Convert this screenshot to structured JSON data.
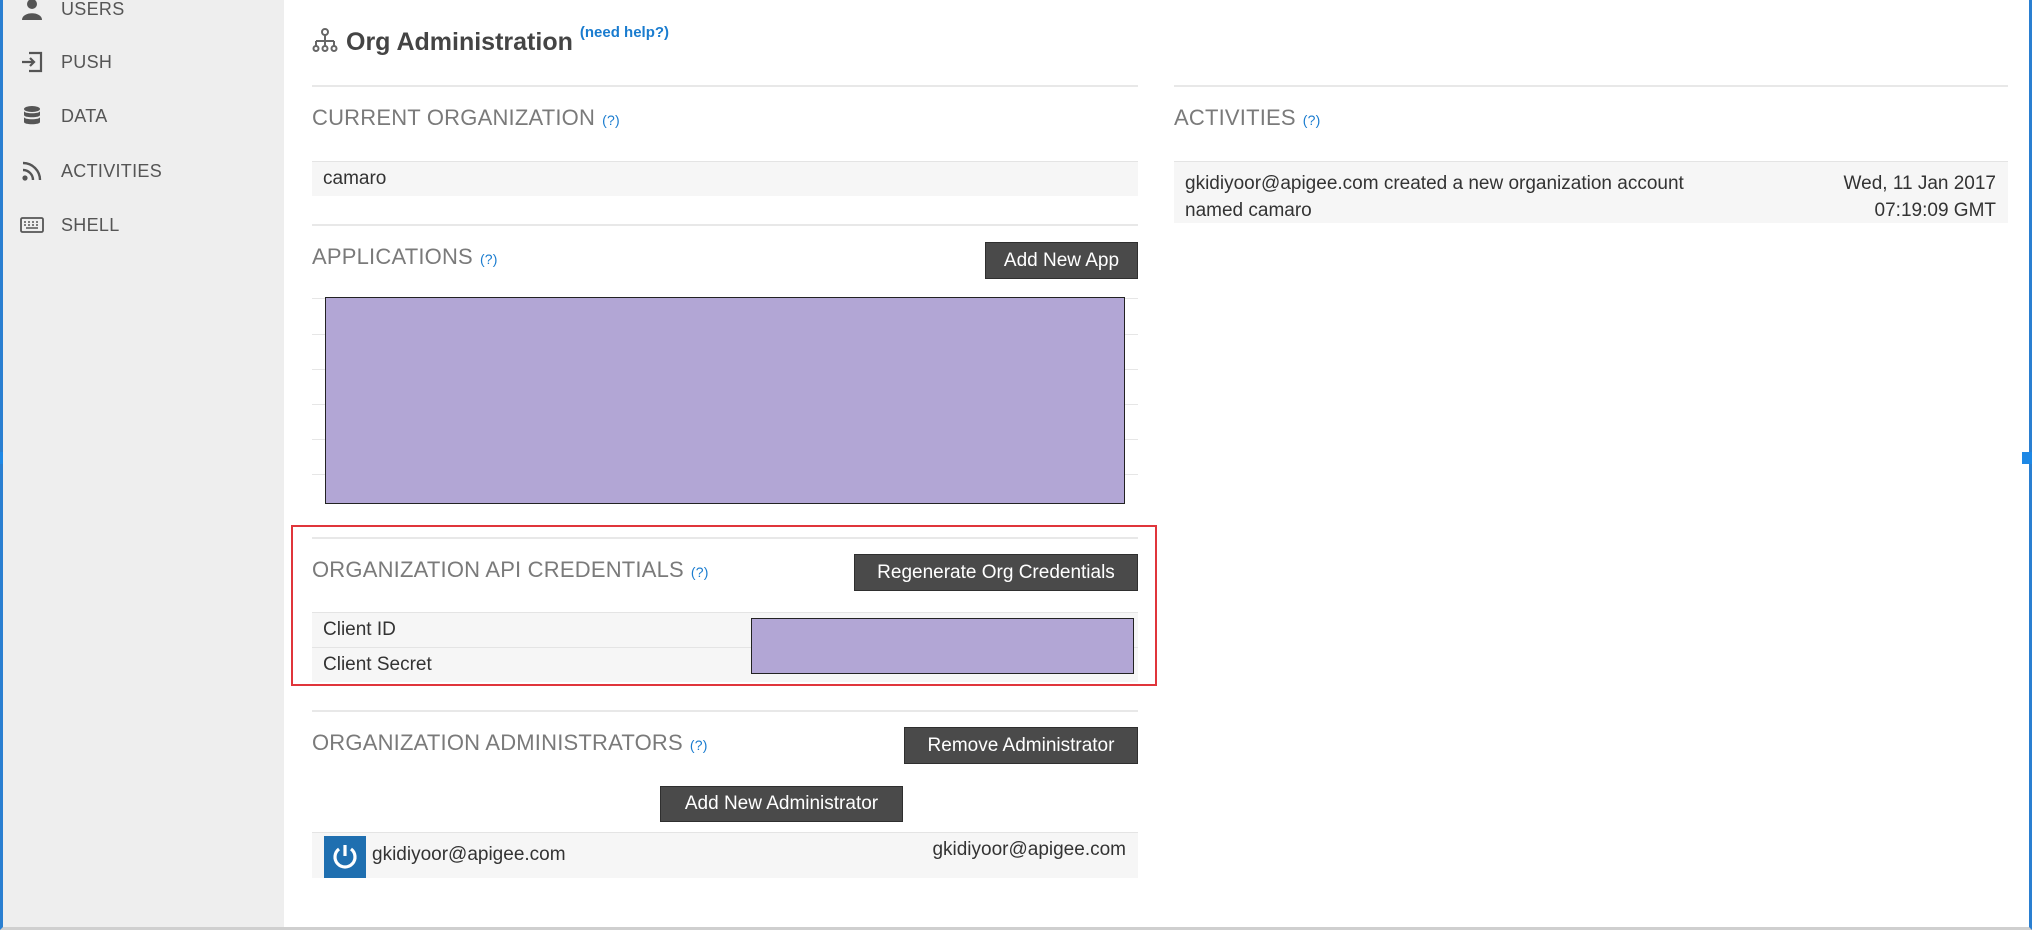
{
  "sidebar": {
    "items": [
      {
        "label": "USERS",
        "icon": "user-icon"
      },
      {
        "label": "PUSH",
        "icon": "push-icon"
      },
      {
        "label": "DATA",
        "icon": "database-icon"
      },
      {
        "label": "ACTIVITIES",
        "icon": "rss-icon"
      },
      {
        "label": "SHELL",
        "icon": "keyboard-icon"
      }
    ]
  },
  "header": {
    "title": "Org Administration",
    "help_link": "(need help?)",
    "icon": "org-tree-icon"
  },
  "current_org": {
    "title": "CURRENT ORGANIZATION",
    "help": "(?)",
    "value": "camaro"
  },
  "applications": {
    "title": "APPLICATIONS",
    "help": "(?)",
    "add_button": "Add New App"
  },
  "credentials": {
    "title": "ORGANIZATION API CREDENTIALS",
    "help": "(?)",
    "regenerate_button": "Regenerate Org Credentials",
    "client_id_label": "Client ID",
    "client_secret_label": "Client Secret"
  },
  "administrators": {
    "title": "ORGANIZATION ADMINISTRATORS",
    "help": "(?)",
    "remove_button": "Remove Administrator",
    "add_button": "Add New Administrator",
    "rows": [
      {
        "name": "gkidiyoor@apigee.com",
        "email": "gkidiyoor@apigee.com"
      }
    ]
  },
  "activities": {
    "title": "ACTIVITIES",
    "help": "(?)",
    "items": [
      {
        "message": "gkidiyoor@apigee.com created a new organization account named camaro",
        "date": "Wed, 11 Jan 2017",
        "time": "07:19:09 GMT"
      }
    ]
  },
  "colors": {
    "accent": "#1a7ccf",
    "button": "#4a4a4a",
    "redaction": "#b2a6d5",
    "highlight_border": "#e0353b"
  }
}
